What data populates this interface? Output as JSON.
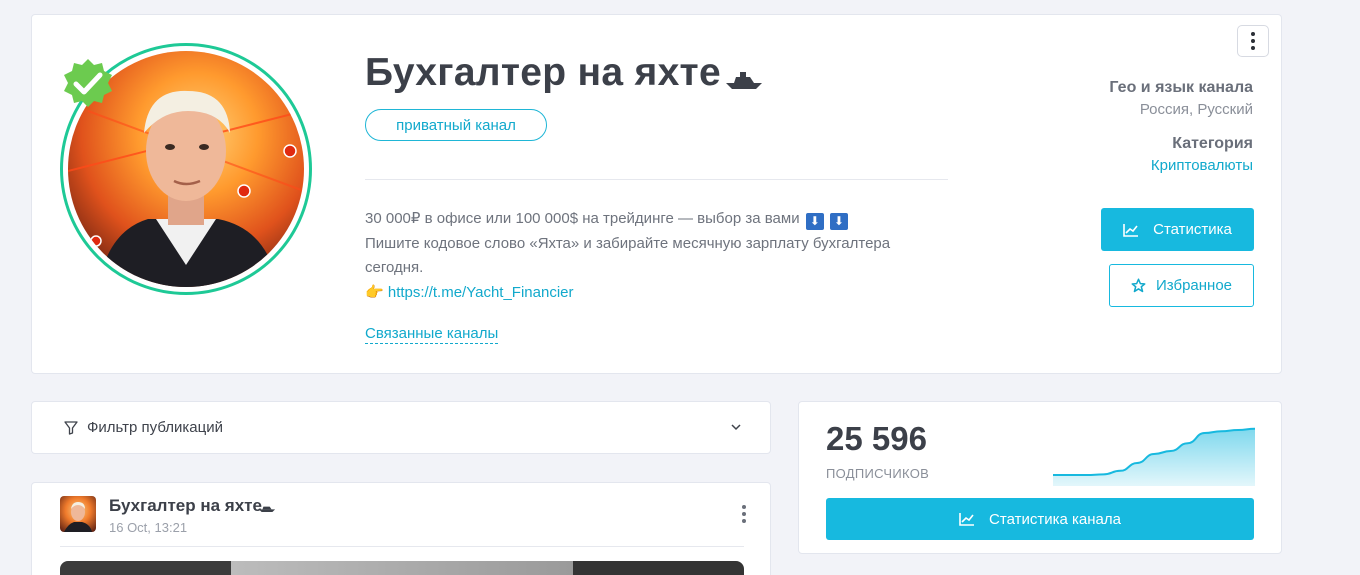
{
  "channel": {
    "title": "Бухгалтер на яхте",
    "title_icon": "ship-icon",
    "verified": true,
    "privacy_tag": "приватный канал",
    "description": {
      "line1": "30 000₽ в офисе или 100 000$ на трейдинге — выбор за вами",
      "line1_emoji": [
        "⬇",
        "⬇"
      ],
      "line2": "Пишите кодовое слово «Яхта» и забирайте месячную зарплату бухгалтера сегодня.",
      "link_emoji": "👉",
      "link": "https://t.me/Yacht_Financier"
    },
    "related_link": "Связанные каналы",
    "meta": {
      "geo_label": "Гео и язык канала",
      "geo_value": "Россия, Русский",
      "category_label": "Категория",
      "category_value": "Криптовалюты"
    },
    "buttons": {
      "stats": "Статистика",
      "favorite": "Избранное"
    }
  },
  "filter": {
    "label": "Фильтр публикаций"
  },
  "post": {
    "author": "Бухгалтер на яхте",
    "date": "16 Oct, 13:21"
  },
  "subscribers": {
    "count": "25 596",
    "label": "ПОДПИСЧИКОВ",
    "trend": [
      0.15,
      0.15,
      0.15,
      0.16,
      0.22,
      0.35,
      0.5,
      0.55,
      0.68,
      0.85,
      0.88,
      0.9,
      0.92
    ],
    "button": "Статистика канала"
  },
  "colors": {
    "accent": "#17b9df",
    "verified": "#6ccb4f",
    "ring": "#1ec996",
    "background": "#f2f3f8"
  }
}
